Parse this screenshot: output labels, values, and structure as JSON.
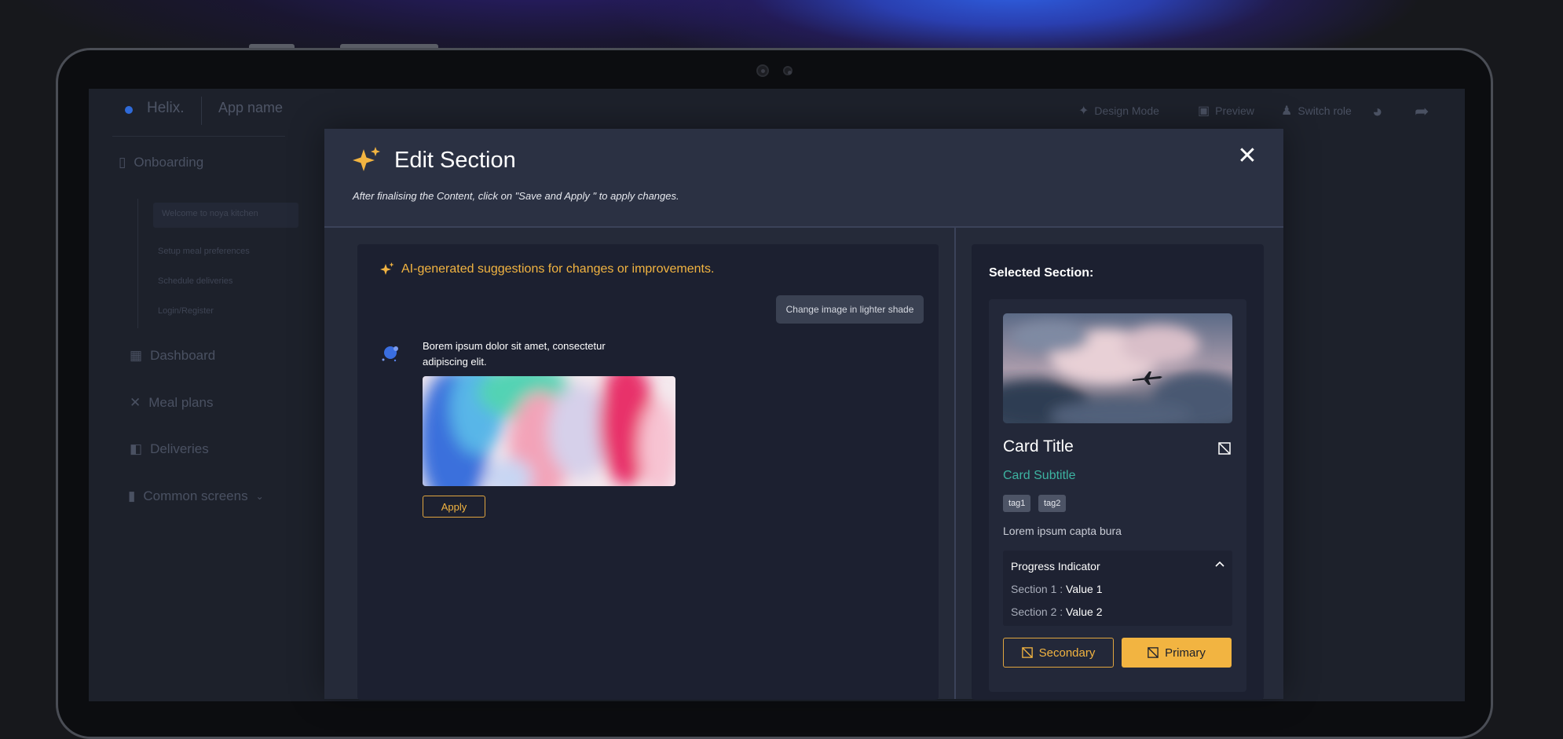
{
  "app": {
    "brand": "Helix.",
    "app_name": "App name",
    "toolbar": {
      "design_mode": "Design Mode",
      "preview": "Preview",
      "switch_role": "Switch role"
    },
    "sidebar": {
      "section": "Onboarding",
      "sub_items": [
        "Welcome to noya kitchen",
        "Setup meal preferences",
        "Schedule deliveries",
        "Login/Register"
      ],
      "items": [
        "Dashboard",
        "Meal plans",
        "Deliveries",
        "Common screens"
      ]
    }
  },
  "modal": {
    "title": "Edit Section",
    "description": "After finalising the Content, click on \"Save and Apply \" to apply changes.",
    "close_icon": "close-icon",
    "suggestions": {
      "heading": "AI-generated suggestions for changes or improvements.",
      "user_chip": "Change image in lighter shade",
      "bot_message": "Borem ipsum dolor sit amet, consectetur adipiscing elit.",
      "apply_label": "Apply"
    },
    "selected": {
      "label": "Selected Section:",
      "card_title": "Card Title",
      "card_subtitle": "Card Subtitle",
      "tags": [
        "tag1",
        "tag2"
      ],
      "body": "Lorem ipsum capta bura",
      "progress": {
        "title": "Progress Indicator",
        "rows": [
          {
            "label": "Section 1 : ",
            "value": "Value 1"
          },
          {
            "label": "Section 2 : ",
            "value": "Value 2"
          }
        ]
      },
      "secondary_label": "Secondary",
      "primary_label": "Primary"
    }
  },
  "colors": {
    "accent": "#f2b441",
    "subtitle": "#3db3a1",
    "modal_bg": "#2b3143",
    "panel_bg": "#1c2030"
  }
}
